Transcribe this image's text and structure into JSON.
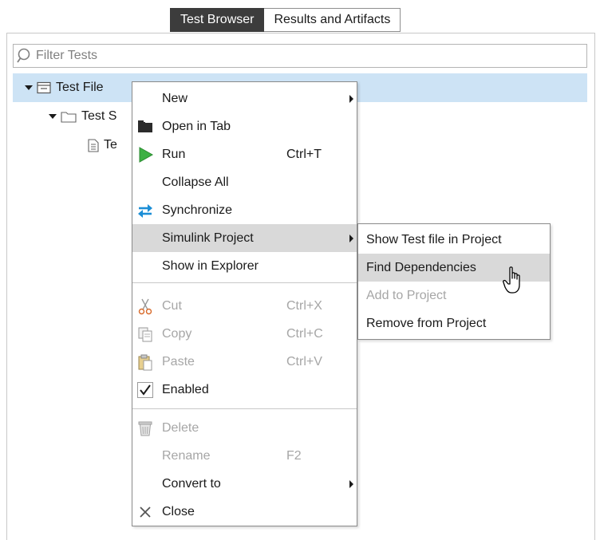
{
  "tabs": [
    {
      "label": "Test Browser",
      "active": true
    },
    {
      "label": "Results and Artifacts",
      "active": false
    }
  ],
  "filter": {
    "placeholder": "Filter Tests",
    "icon": "search-icon"
  },
  "tree": [
    {
      "label": "Test File",
      "icon": "test-file-icon",
      "expanded": true,
      "selected": true
    },
    {
      "label": "Test S",
      "icon": "folder-icon",
      "expanded": true
    },
    {
      "label": "Te",
      "icon": "document-icon"
    }
  ],
  "context_menu": {
    "items": [
      {
        "label": "New",
        "icon": "",
        "shortcut": "",
        "submenu": true,
        "enabled": true
      },
      {
        "label": "Open in Tab",
        "icon": "open-tab-icon",
        "shortcut": "",
        "enabled": true
      },
      {
        "label": "Run",
        "icon": "run-icon",
        "shortcut": "Ctrl+T",
        "enabled": true
      },
      {
        "label": "Collapse All",
        "icon": "",
        "shortcut": "",
        "enabled": true
      },
      {
        "label": "Synchronize",
        "icon": "synchronize-icon",
        "shortcut": "",
        "enabled": true
      },
      {
        "label": "Simulink Project",
        "icon": "",
        "shortcut": "",
        "submenu": true,
        "enabled": true,
        "highlighted": true
      },
      {
        "label": "Show in Explorer",
        "icon": "",
        "shortcut": "",
        "enabled": true
      },
      {
        "label": "Cut",
        "icon": "scissors-icon",
        "shortcut": "Ctrl+X",
        "enabled": false
      },
      {
        "label": "Copy",
        "icon": "copy-icon",
        "shortcut": "Ctrl+C",
        "enabled": false
      },
      {
        "label": "Paste",
        "icon": "paste-icon",
        "shortcut": "Ctrl+V",
        "enabled": false
      },
      {
        "label": "Enabled",
        "icon": "checkmark-icon",
        "shortcut": "",
        "enabled": true,
        "checked": true
      },
      {
        "label": "Delete",
        "icon": "trash-icon",
        "shortcut": "",
        "enabled": false
      },
      {
        "label": "Rename",
        "icon": "",
        "shortcut": "F2",
        "enabled": false
      },
      {
        "label": "Convert to",
        "icon": "",
        "shortcut": "",
        "submenu": true,
        "enabled": true
      },
      {
        "label": "Close",
        "icon": "close-icon",
        "shortcut": "",
        "enabled": true
      }
    ]
  },
  "submenu": {
    "items": [
      {
        "label": "Show Test file in Project",
        "enabled": true
      },
      {
        "label": "Find Dependencies",
        "enabled": true,
        "highlighted": true
      },
      {
        "label": "Add to Project",
        "enabled": false
      },
      {
        "label": "Remove from Project",
        "enabled": true
      }
    ]
  },
  "colors": {
    "selection": "#cde3f5",
    "menu_highlight": "#d9d9d9",
    "disabled_text": "#a6a6a6",
    "active_tab": "#3c3c3c",
    "run_green": "#3cb043",
    "sync_blue": "#1c8ed6"
  }
}
